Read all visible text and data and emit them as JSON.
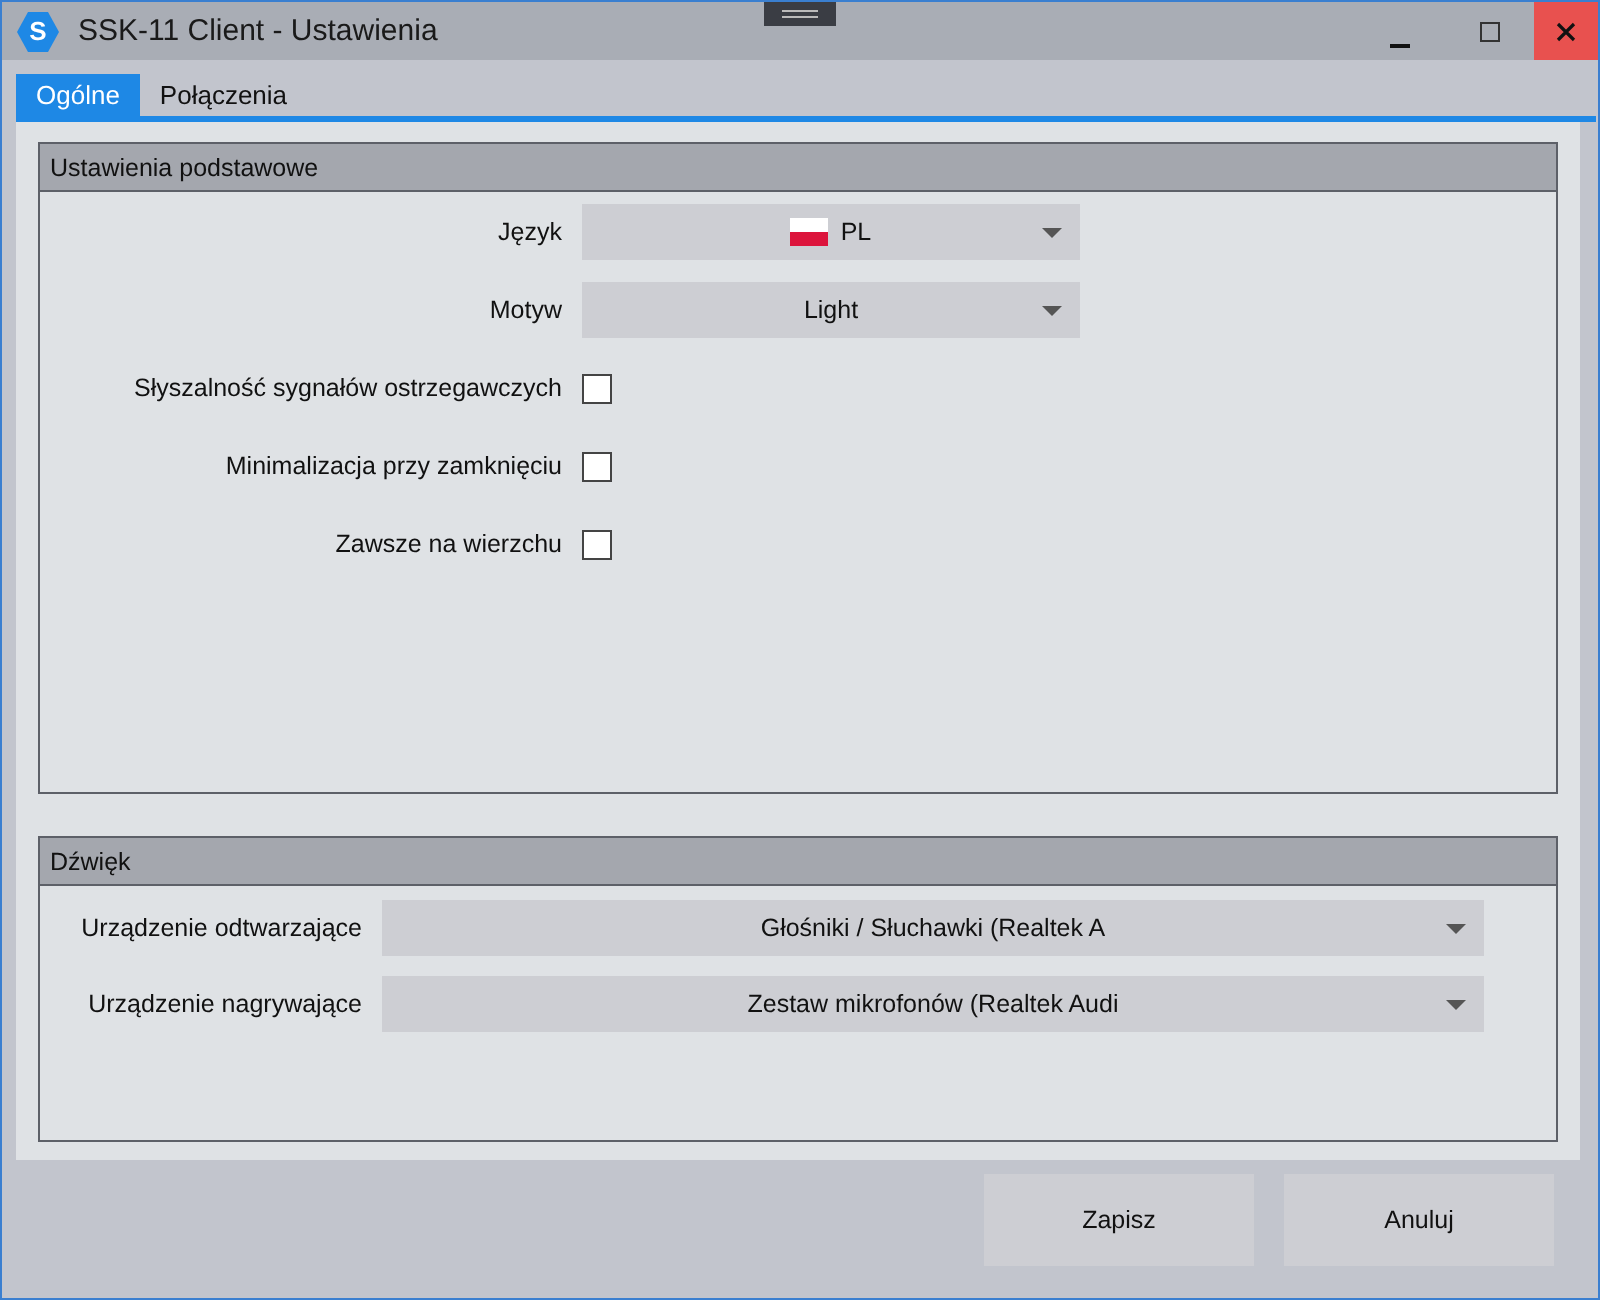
{
  "window": {
    "title": "SSK-11 Client - Ustawienia",
    "app_icon_letter": "S"
  },
  "tabs": [
    {
      "label": "Ogólne",
      "selected": true
    },
    {
      "label": "Połączenia",
      "selected": false
    }
  ],
  "sections": [
    {
      "title": "Ustawienia podstawowe",
      "rows": [
        {
          "kind": "flag-dropdown",
          "label": "Język",
          "value": "PL"
        },
        {
          "kind": "dropdown",
          "label": "Motyw",
          "value": "Light"
        },
        {
          "kind": "checkbox",
          "label": "Słyszalność sygnałów ostrzegawczych",
          "checked": false
        },
        {
          "kind": "checkbox",
          "label": "Minimalizacja przy zamknięciu",
          "checked": false
        },
        {
          "kind": "checkbox",
          "label": "Zawsze na wierzchu",
          "checked": false
        }
      ]
    },
    {
      "title": "Dźwięk",
      "rows": [
        {
          "kind": "dropdown",
          "label": "Urządzenie odtwarzające",
          "value": "Głośniki / Słuchawki (Realtek A"
        },
        {
          "kind": "dropdown",
          "label": "Urządzenie nagrywające",
          "value": "Zestaw mikrofonów (Realtek Audi"
        }
      ]
    }
  ],
  "buttons": [
    "Zapisz",
    "Anuluj"
  ]
}
